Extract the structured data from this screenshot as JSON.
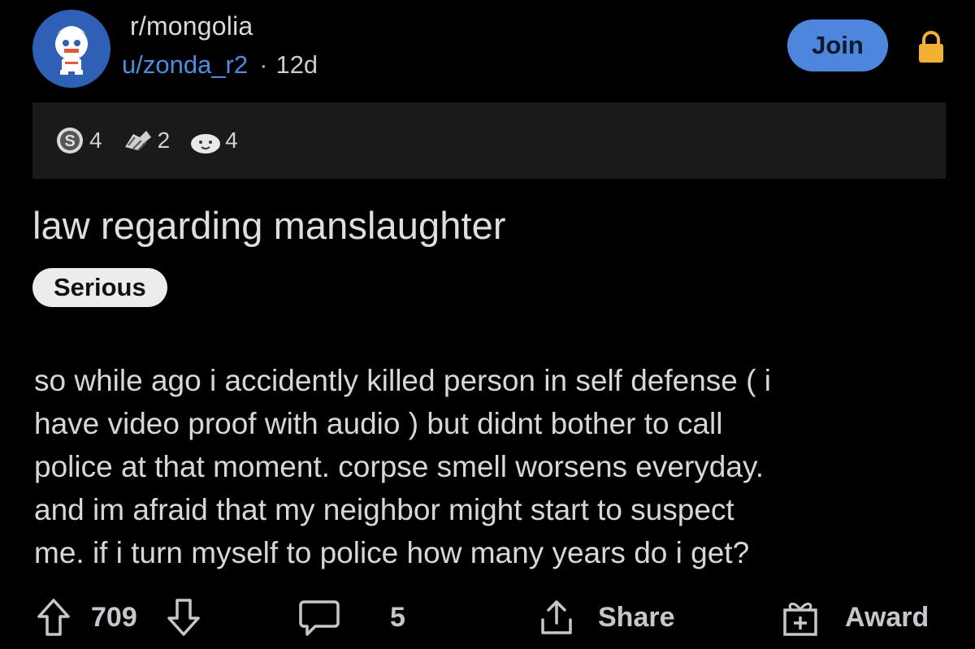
{
  "post": {
    "subreddit": "r/mongolia",
    "username": "u/zonda_r2",
    "separator": "·",
    "age": "12d",
    "join_label": "Join",
    "awards": [
      {
        "icon": "silver-award-icon",
        "count": "4"
      },
      {
        "icon": "helpful-award-icon",
        "count": "2"
      },
      {
        "icon": "wholesome-award-icon",
        "count": "4"
      }
    ],
    "title": "law regarding manslaughter",
    "flair": "Serious",
    "body": "so while ago i accidently killed person in self defense ( i\nhave video proof with audio )  but didnt bother to call\npolice at that moment.  corpse smell worsens everyday.\nand im afraid that my neighbor might start to suspect\nme.  if i turn myself to police how many years do i get?"
  },
  "actions": {
    "upvote_icon": "upvote-arrow-icon",
    "score": "709",
    "downvote_icon": "downvote-arrow-icon",
    "comment_icon": "comment-bubble-icon",
    "comment_count": "5",
    "share_icon": "share-icon",
    "share_label": "Share",
    "award_icon": "gift-award-icon",
    "award_label": "Award"
  },
  "colors": {
    "background": "#000000",
    "avatar_bg": "#2e61b5",
    "username": "#4f8be0",
    "join_button": "#4d86dc",
    "lock": "#f2b134",
    "awards_bar": "#1a1a1b",
    "flair_bg": "#ececec"
  }
}
